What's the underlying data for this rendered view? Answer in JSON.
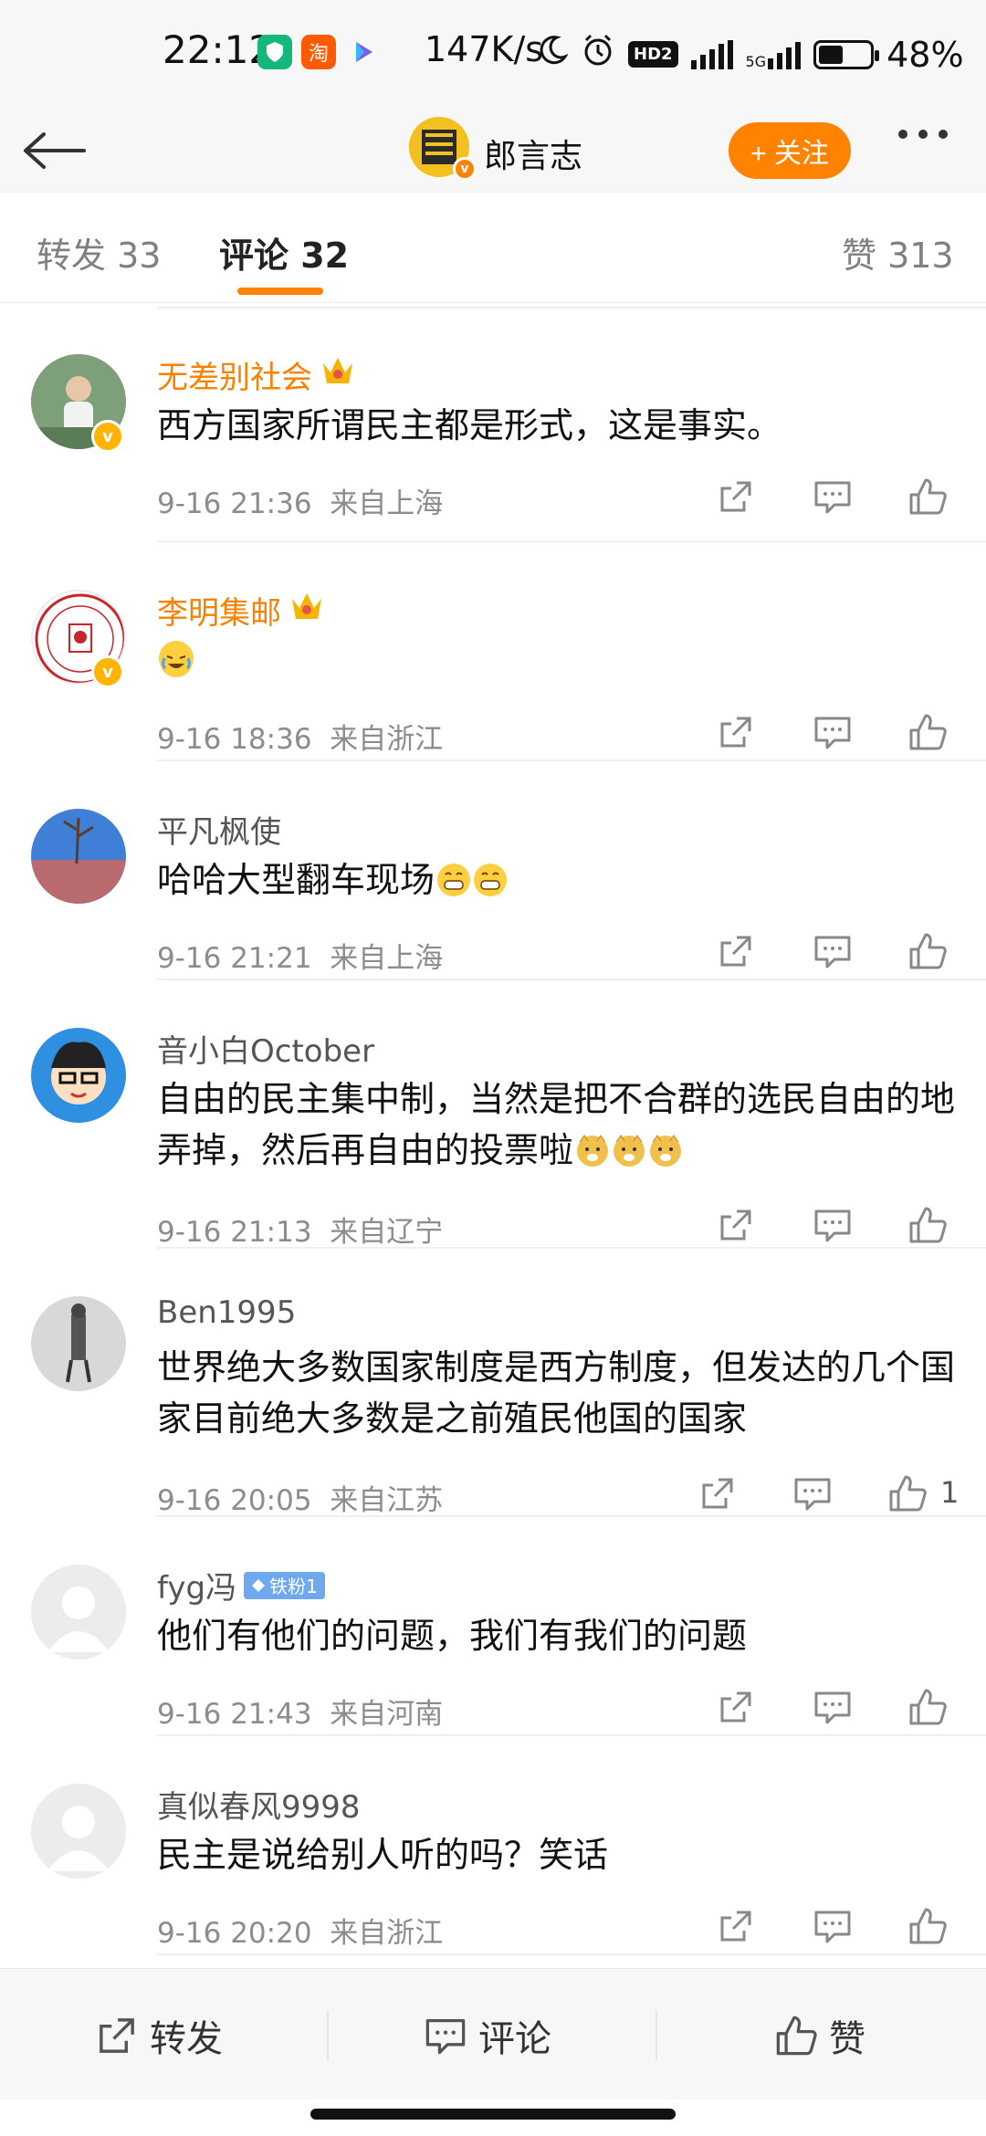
{
  "status_bar": {
    "time": "22:12",
    "app_icons": [
      "shield-icon",
      "taobao-icon",
      "video-icon"
    ],
    "taobao_char": "淘",
    "speed": "147K/s",
    "hd_label": "HD2",
    "net_label": "5G",
    "battery_level": 0.48,
    "battery_pct": "48%"
  },
  "header": {
    "title": "郎言志",
    "follow_label": "+ 关注"
  },
  "tabs": {
    "repost": "转发 33",
    "comment": "评论 32",
    "like": "赞 313"
  },
  "comments": [
    {
      "user": "无差别社会",
      "vip": true,
      "crown": true,
      "text": "西方国家所谓民主都是形式，这是事实。",
      "time": "9-16 21:36",
      "location": "来自上海",
      "likes": ""
    },
    {
      "user": "李明集邮",
      "vip": true,
      "crown": true,
      "text": "",
      "emoji": [
        "laugh-cry"
      ],
      "time": "9-16 18:36",
      "location": "来自浙江",
      "likes": ""
    },
    {
      "user": "平凡枫使",
      "vip": false,
      "text": "哈哈大型翻车现场",
      "emoji": [
        "grin",
        "grin"
      ],
      "time": "9-16 21:21",
      "location": "来自上海",
      "likes": ""
    },
    {
      "user": "音小白October",
      "vip": false,
      "text": "自由的民主集中制，当然是把不合群的选民自由的地弄掉，然后再自由的投票啦",
      "emoji": [
        "doge",
        "doge",
        "doge"
      ],
      "time": "9-16 21:13",
      "location": "来自辽宁",
      "likes": ""
    },
    {
      "user": "Ben1995",
      "vip": false,
      "text": "世界绝大多数国家制度是西方制度，但发达的几个国家目前绝大多数是之前殖民他国的国家",
      "time": "9-16 20:05",
      "location": "来自江苏",
      "likes": "1"
    },
    {
      "user": "fyg冯",
      "vip": false,
      "fan_badge": "铁粉1",
      "text": "他们有他们的问题，我们有我们的问题",
      "time": "9-16 21:43",
      "location": "来自河南",
      "likes": ""
    },
    {
      "user": "真似春风9998",
      "vip": false,
      "text": "民主是说给别人听的吗？笑话",
      "time": "9-16 20:20",
      "location": "来自浙江",
      "likes": ""
    }
  ],
  "bottom_bar": {
    "repost": "转发",
    "comment": "评论",
    "like": "赞"
  },
  "colors": {
    "accent": "#ff8200",
    "vip_name": "#f78100",
    "meta": "#8c8c8c"
  }
}
